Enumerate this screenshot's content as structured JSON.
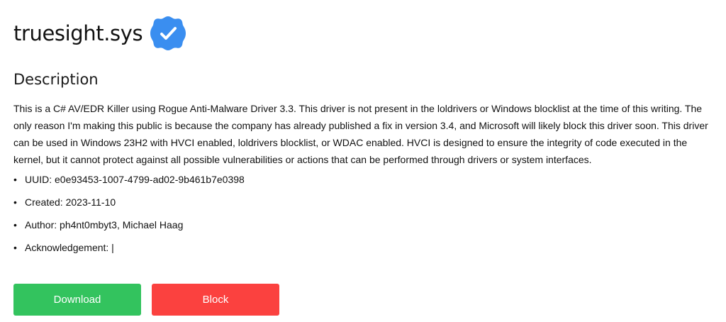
{
  "driver": {
    "name": "truesight.sys",
    "verified_icon": "verified-badge-icon",
    "verified_color": "#3a8ef0"
  },
  "description": {
    "heading": "Description",
    "text": "This is a C# AV/EDR Killer using Rogue Anti-Malware Driver 3.3. This driver is not present in the loldrivers or Windows blocklist at the time of this writing. The only reason I'm making this public is because the company has already published a fix in version 3.4, and Microsoft will likely block this driver soon. This driver can be used in Windows 23H2 with HVCI enabled, loldrivers blocklist, or WDAC enabled. HVCI is designed to ensure the integrity of code executed in the kernel, but it cannot protect against all possible vulnerabilities or actions that can be performed through drivers or system interfaces."
  },
  "meta": {
    "uuid": "UUID: e0e93453-1007-4799-ad02-9b461b7e0398",
    "created": "Created: 2023-11-10",
    "author": "Author: ph4nt0mbyt3, Michael Haag",
    "acknowledgement": "Acknowledgement: |"
  },
  "actions": {
    "download_label": "Download",
    "download_color": "#33c35e",
    "block_label": "Block",
    "block_color": "#fb413f"
  }
}
